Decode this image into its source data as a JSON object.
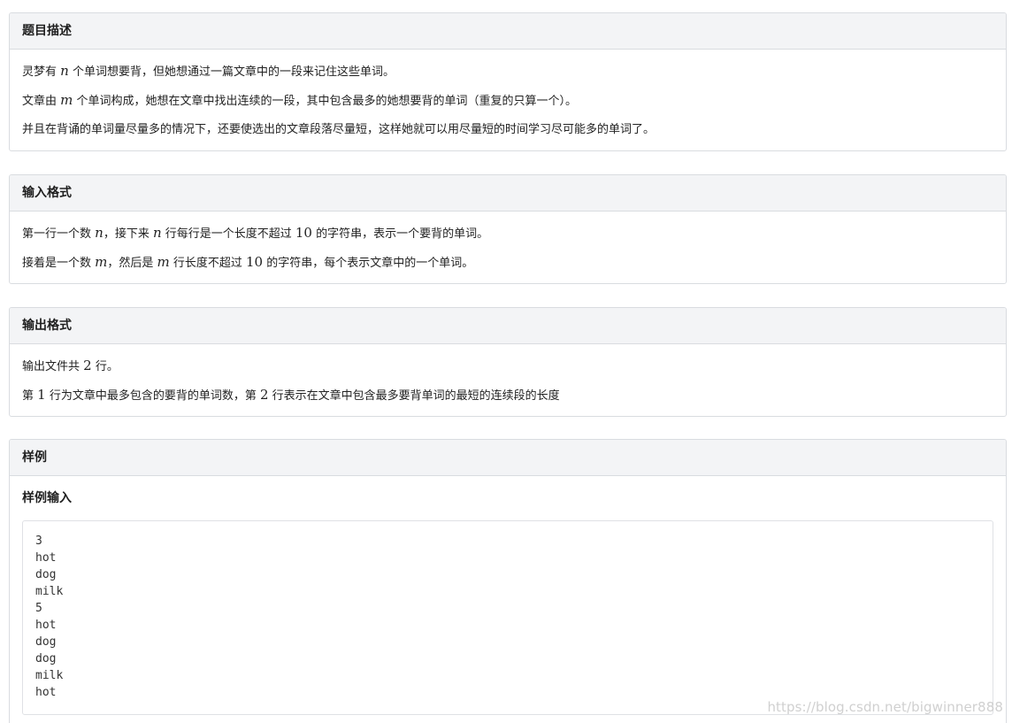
{
  "description": {
    "title": "题目描述",
    "p1": {
      "a": "灵梦有 ",
      "var": "n",
      "b": " 个单词想要背，但她想通过一篇文章中的一段来记住这些单词。"
    },
    "p2": {
      "a": "文章由 ",
      "var": "m",
      "b": " 个单词构成，她想在文章中找出连续的一段，其中包含最多的她想要背的单词（重复的只算一个）。"
    },
    "p3": "并且在背诵的单词量尽量多的情况下，还要使选出的文章段落尽量短，这样她就可以用尽量短的时间学习尽可能多的单词了。"
  },
  "input_format": {
    "title": "输入格式",
    "p1": {
      "a": "第一行一个数 ",
      "var1": "n",
      "b": "，接下来 ",
      "var2": "n",
      "c": " 行每行是一个长度不超过 ",
      "num": "10",
      "d": " 的字符串，表示一个要背的单词。"
    },
    "p2": {
      "a": "接着是一个数 ",
      "var1": "m",
      "b": "，然后是 ",
      "var2": "m",
      "c": " 行长度不超过 ",
      "num": "10",
      "d": " 的字符串，每个表示文章中的一个单词。"
    }
  },
  "output_format": {
    "title": "输出格式",
    "p1": {
      "a": "输出文件共 ",
      "num": "2",
      "b": " 行。"
    },
    "p2": {
      "a": "第 ",
      "num1": "1",
      "b": " 行为文章中最多包含的要背的单词数，第 ",
      "num2": "2",
      "c": " 行表示在文章中包含最多要背单词的最短的连续段的长度"
    }
  },
  "sample": {
    "title": "样例",
    "input_title": "样例输入",
    "input_lines": [
      "3",
      "hot",
      "dog",
      "milk",
      "5",
      "hot",
      "dog",
      "dog",
      "milk",
      "hot"
    ]
  },
  "watermark": "https://blog.csdn.net/bigwinner888"
}
